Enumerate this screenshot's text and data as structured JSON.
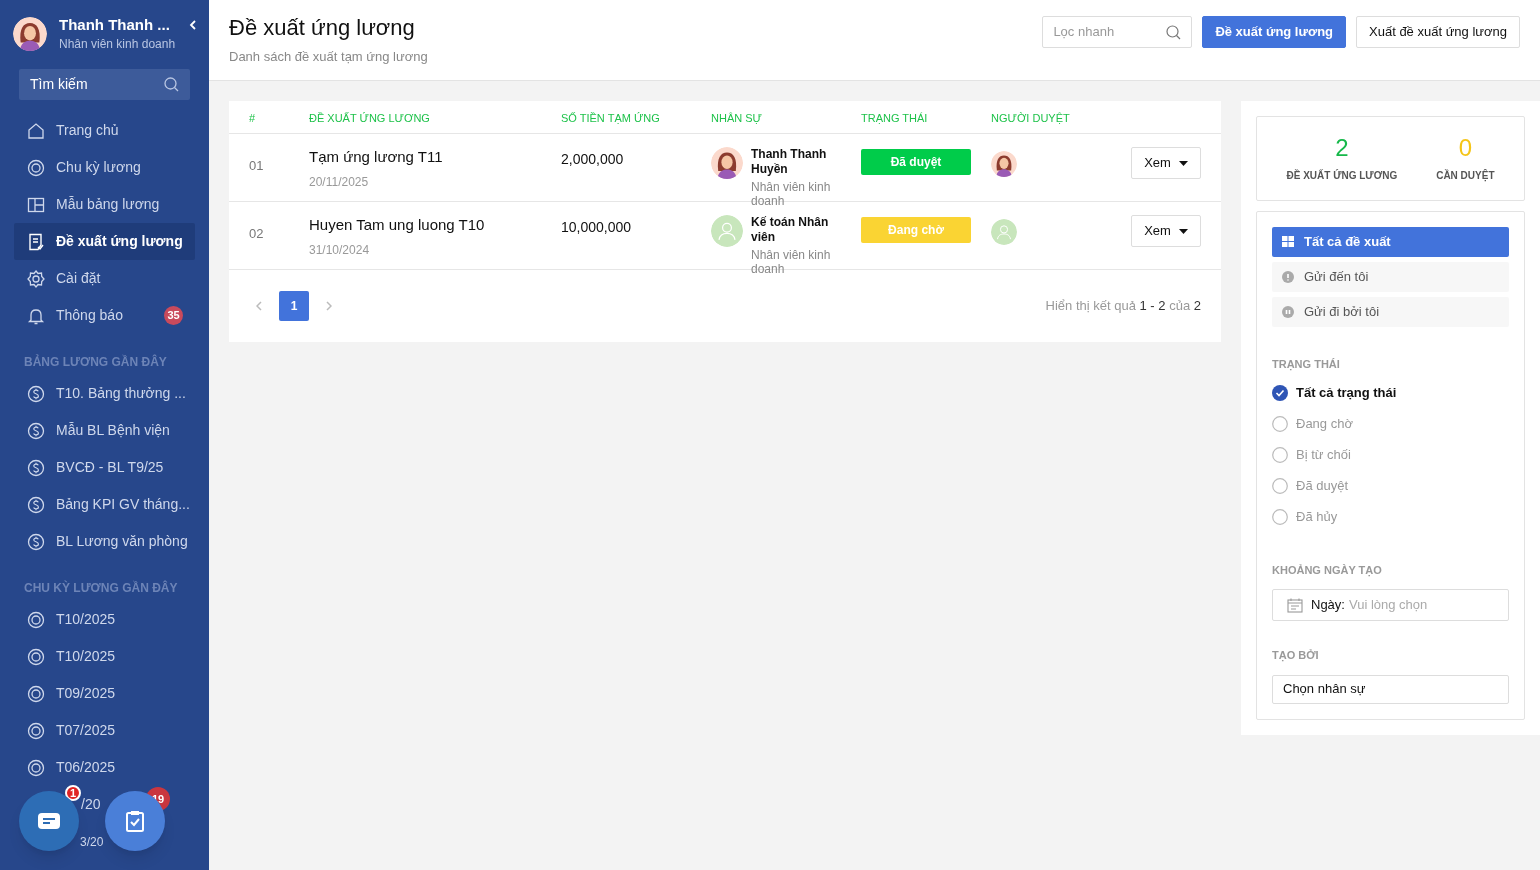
{
  "user": {
    "name": "Thanh Thanh ...",
    "role": "Nhân viên kinh doanh",
    "avatar": {
      "kind": "photo"
    }
  },
  "sidebar": {
    "search_placeholder": "Tìm kiếm",
    "nav": [
      {
        "label": "Trang chủ",
        "selected": false
      },
      {
        "label": "Chu kỳ lương",
        "selected": false
      },
      {
        "label": "Mẫu bảng lương",
        "selected": false
      },
      {
        "label": "Đề xuất ứng lương",
        "selected": true
      },
      {
        "label": "Cài đặt",
        "selected": false
      },
      {
        "label": "Thông báo",
        "selected": false,
        "badge": "35"
      }
    ],
    "sections": [
      {
        "title": "BẢNG LƯƠNG GẦN ĐÂY",
        "kind": "payroll",
        "items": [
          {
            "label": "T10. Bảng thưởng ..."
          },
          {
            "label": "Mẫu BL Bệnh viện"
          },
          {
            "label": "BVCĐ - BL T9/25"
          },
          {
            "label": "Bảng KPI GV tháng..."
          },
          {
            "label": "BL Lương văn phòng"
          }
        ]
      },
      {
        "title": "CHU KỲ LƯƠNG GẦN ĐÂY",
        "kind": "cycle",
        "items": [
          {
            "label": "T10/2025"
          },
          {
            "label": "T10/2025"
          },
          {
            "label": "T09/2025"
          },
          {
            "label": "T07/2025"
          },
          {
            "label": "T06/2025"
          },
          {
            "label": "/20",
            "kind": "covered"
          },
          {
            "label": "3/20",
            "kind": "covered"
          }
        ]
      }
    ]
  },
  "floating": [
    {
      "badge": "1"
    },
    {
      "badge": "19"
    }
  ],
  "header": {
    "title": "Đề xuất ứng lương",
    "subtitle": "Danh sách đề xuất tạm ứng lương",
    "search_placeholder": "Lọc nhanh",
    "buttons": [
      {
        "label": "Đề xuất ứng lương",
        "kind": "primary"
      },
      {
        "label": "Xuất đề xuất ứng lương",
        "kind": "outline"
      }
    ]
  },
  "table": {
    "columns": [
      "#",
      "ĐỀ XUẤT ỨNG LƯƠNG",
      "SỐ TIỀN TẠM ỨNG",
      "NHÂN SỰ",
      "TRẠNG THÁI",
      "NGƯỜI DUYỆT"
    ],
    "rows": [
      {
        "index": "01",
        "title": "Tạm ứng lương T11",
        "date": "20/11/2025",
        "amount": "2,000,000",
        "staff": {
          "name": "Thanh Thanh Huyền",
          "role": "Nhân viên kinh doanh",
          "avatar": {
            "kind": "photo"
          }
        },
        "status": {
          "label": "Đã duyệt",
          "color": "#00cc4a"
        },
        "approver_avatar": {
          "kind": "photo"
        },
        "action": "Xem"
      },
      {
        "index": "02",
        "title": "Huyen Tam ung luong T10",
        "date": "31/10/2024",
        "amount": "10,000,000",
        "staff": {
          "name": "Kế toán Nhân viên",
          "role": "Nhân viên kinh doanh",
          "avatar": {
            "kind": "placeholder"
          }
        },
        "status": {
          "label": "Đang chờ",
          "color": "#fad433"
        },
        "approver_avatar": {
          "kind": "placeholder"
        },
        "action": "Xem"
      }
    ],
    "pages": [
      {
        "label": "1",
        "selected": true
      }
    ],
    "summary": [
      "Hiển thị kết quả",
      "1 - 2",
      "của",
      "2"
    ]
  },
  "panel": {
    "stats": [
      {
        "value": "2",
        "label": "ĐỀ XUẤT ỨNG LƯƠNG",
        "color": "#16b84a"
      },
      {
        "value": "0",
        "label": "CẦN DUYỆT",
        "color": "#f5c518"
      }
    ],
    "filters": [
      {
        "label": "Tất cả đề xuất",
        "selected": true
      },
      {
        "label": "Gửi đến tôi",
        "selected": false
      },
      {
        "label": "Gửi đi bởi tôi",
        "selected": false
      }
    ],
    "status_title": "TRẠNG THÁI",
    "statuses": [
      {
        "label": "Tất cả trạng thái",
        "checked": true
      },
      {
        "label": "Đang chờ",
        "checked": false
      },
      {
        "label": "Bị từ chối",
        "checked": false
      },
      {
        "label": "Đã duyệt",
        "checked": false
      },
      {
        "label": "Đã hủy",
        "checked": false
      }
    ],
    "date_title": "KHOẢNG NGÀY TẠO",
    "date_prefix": "Ngày:",
    "date_placeholder": "Vui lòng chọn",
    "creator_title": "TẠO BỞI",
    "creator_placeholder": "Chọn nhân sự"
  }
}
